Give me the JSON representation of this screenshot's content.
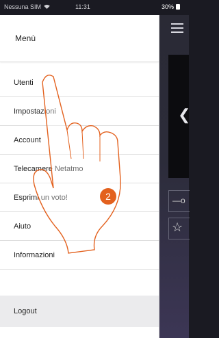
{
  "status_bar": {
    "carrier": "Nessuna SIM",
    "time": "11:31",
    "battery": "30%"
  },
  "menu": {
    "title": "Menù",
    "items": [
      {
        "label": "Utenti"
      },
      {
        "label": "Impostazioni"
      },
      {
        "label": "Account"
      },
      {
        "label": "Telecamere Netatmo"
      },
      {
        "label": "Esprimi un voto!"
      },
      {
        "label": "Aiuto"
      },
      {
        "label": "Informazioni"
      }
    ],
    "logout_label": "Logout"
  },
  "callout": {
    "step": "2",
    "color": "#e3611e"
  },
  "icons": [
    "wifi-icon",
    "battery-icon",
    "hamburger-icon",
    "chevron-left-icon",
    "key-icon",
    "star-icon",
    "hand-pointer-icon"
  ]
}
